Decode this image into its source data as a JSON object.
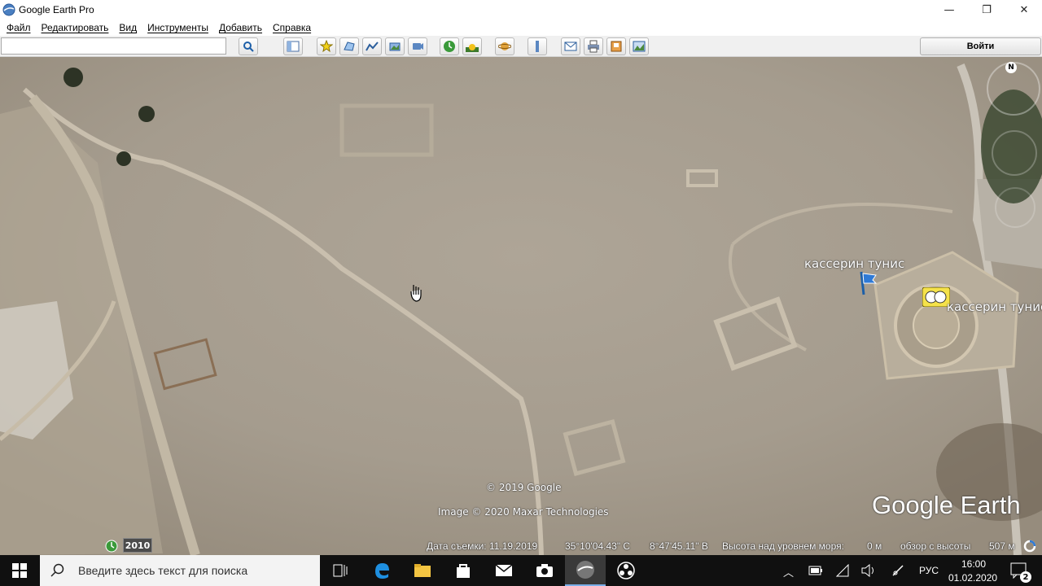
{
  "window": {
    "title": "Google Earth Pro",
    "minimize_glyph": "—",
    "maximize_glyph": "❐",
    "close_glyph": "✕"
  },
  "menu": {
    "items": [
      {
        "label": "Файл"
      },
      {
        "label": "Редактировать"
      },
      {
        "label": "Вид"
      },
      {
        "label": "Инструменты"
      },
      {
        "label": "Добавить"
      },
      {
        "label": "Справка"
      }
    ]
  },
  "toolbar": {
    "search_value": "",
    "signin_label": "Войти",
    "buttons": [
      {
        "icon": "search-icon"
      },
      {
        "icon": "sidebar-toggle-icon"
      },
      {
        "icon": "add-placemark-icon"
      },
      {
        "icon": "add-polygon-icon"
      },
      {
        "icon": "add-path-icon"
      },
      {
        "icon": "add-image-overlay-icon"
      },
      {
        "icon": "record-tour-icon"
      },
      {
        "icon": "historical-imagery-icon"
      },
      {
        "icon": "sunlight-icon"
      },
      {
        "icon": "planets-icon"
      },
      {
        "icon": "ruler-icon"
      },
      {
        "icon": "email-icon"
      },
      {
        "icon": "print-icon"
      },
      {
        "icon": "save-image-icon"
      },
      {
        "icon": "view-in-maps-icon"
      }
    ]
  },
  "map": {
    "placemark_1": "кассерин тунис",
    "placemark_2": "кассерин тунис",
    "copyright": "© 2019 Google",
    "imagery_credit": "Image © 2020 Maxar Technologies",
    "logo_text": "Google Earth",
    "compass_north": "N",
    "history_year": "2010"
  },
  "status": {
    "imagery_date": "Дата съемки: 11.19.2019",
    "latitude": "35°10'04.43\" С",
    "longitude": "8°47'45.11\" В",
    "elevation_label": "Высота над уровнем моря:",
    "elevation_value": "0 м",
    "eye_alt_label": "обзор с высоты",
    "eye_alt_value": "507 м"
  },
  "taskbar": {
    "search_placeholder": "Введите здесь текст для поиска",
    "language": "РУС",
    "time": "16:00",
    "date": "01.02.2020",
    "notifications_count": "2"
  }
}
